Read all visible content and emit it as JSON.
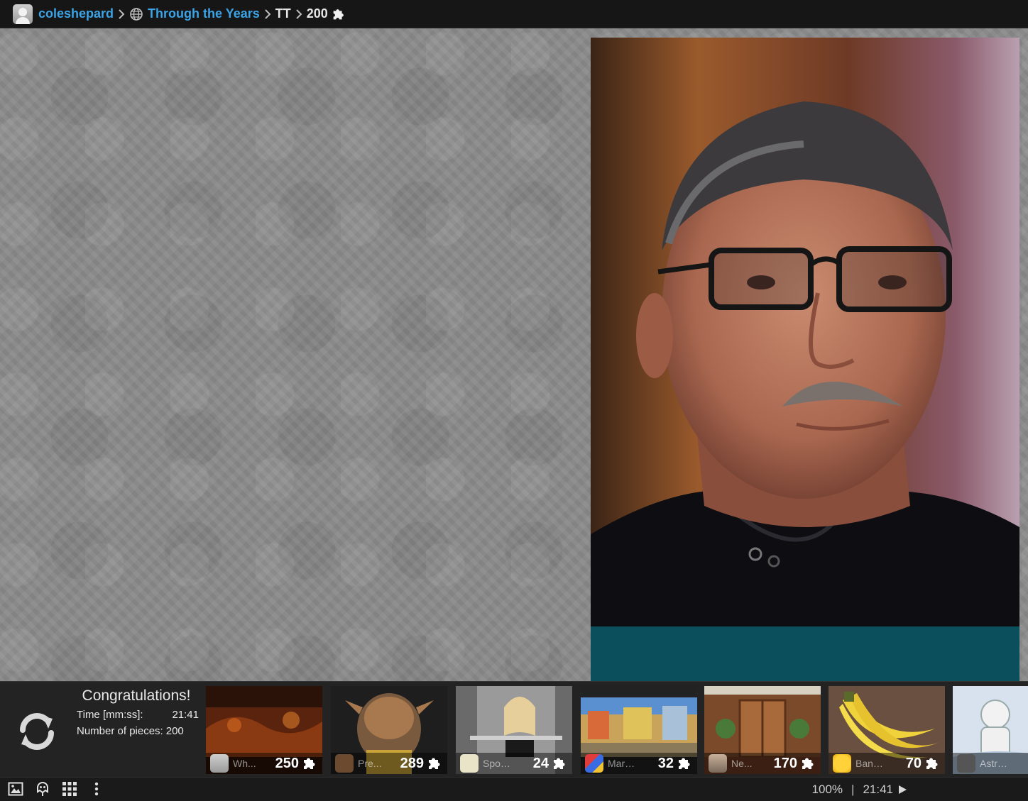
{
  "breadcrumb": {
    "user": "coleshepard",
    "collection": "Through the Years",
    "puzzle": "TT",
    "pieces": "200"
  },
  "result": {
    "title": "Congratulations!",
    "time_label": "Time [mm:ss]:",
    "time_value": "21:41",
    "pieces_label": "Number of pieces:",
    "pieces_value": "200"
  },
  "thumbnails": [
    {
      "name": "Wh...",
      "count": "250",
      "icon": "user-avatar-icon"
    },
    {
      "name": "Pre...",
      "count": "289",
      "icon": "creature-avatar-icon"
    },
    {
      "name": "Sport...",
      "count": "24",
      "icon": "floral-avatar-icon"
    },
    {
      "name": "Mark...",
      "count": "32",
      "icon": "logo-avatar-icon"
    },
    {
      "name": "Ne...",
      "count": "170",
      "icon": "portrait-avatar-icon"
    },
    {
      "name": "Banana",
      "count": "70",
      "icon": "emoji-avatar-icon"
    },
    {
      "name": "Astron...",
      "count": "",
      "icon": "robot-avatar-icon"
    }
  ],
  "status": {
    "zoom": "100%",
    "separator": "|",
    "timer": "21:41"
  },
  "colors": {
    "link": "#3ba4e6",
    "topbar": "#161616",
    "panel": "#232323"
  }
}
